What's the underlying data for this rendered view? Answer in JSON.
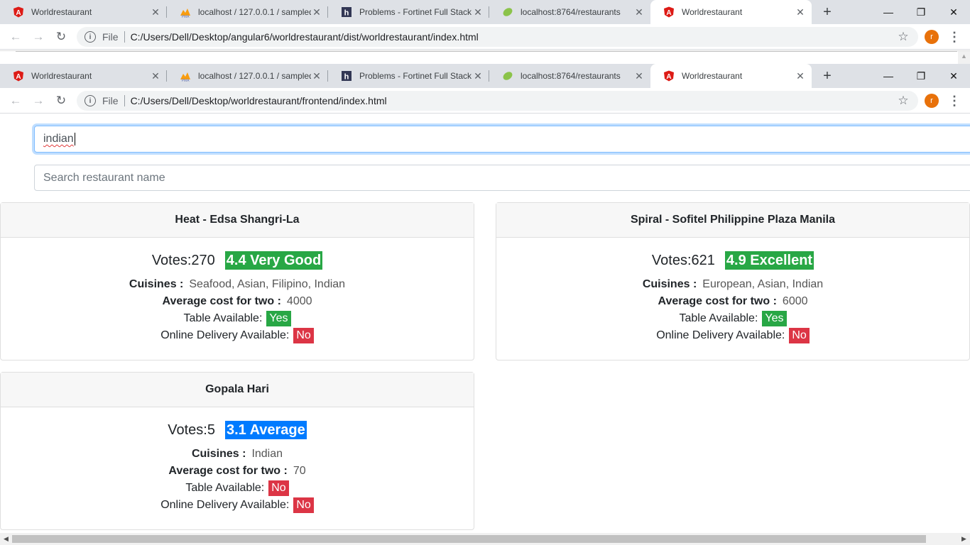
{
  "browser_back": {
    "tabs": [
      {
        "title": "Worldrestaurant",
        "icon": "angular-icon"
      },
      {
        "title": "localhost / 127.0.0.1 / sampled",
        "icon": "phpmyadmin-icon"
      },
      {
        "title": "Problems - Fortinet Full Stack",
        "icon": "hackerearth-icon"
      },
      {
        "title": "localhost:8764/restaurants",
        "icon": "spring-leaf-icon"
      },
      {
        "title": "Worldrestaurant",
        "icon": "angular-icon"
      }
    ],
    "omnibox": {
      "file_label": "File",
      "url": "C:/Users/Dell/Desktop/angular6/worldrestaurant/dist/worldrestaurant/index.html"
    }
  },
  "browser_front": {
    "tabs": [
      {
        "title": "Worldrestaurant",
        "icon": "angular-icon"
      },
      {
        "title": "localhost / 127.0.0.1 / sampled",
        "icon": "phpmyadmin-icon"
      },
      {
        "title": "Problems - Fortinet Full Stack",
        "icon": "hackerearth-icon"
      },
      {
        "title": "localhost:8764/restaurants",
        "icon": "spring-leaf-icon"
      },
      {
        "title": "Worldrestaurant",
        "icon": "angular-icon"
      }
    ],
    "omnibox": {
      "file_label": "File",
      "url": "C:/Users/Dell/Desktop/worldrestaurant/frontend/index.html"
    },
    "avatar_letter": "r"
  },
  "search": {
    "cuisine_value": "indian",
    "name_placeholder": "Search restaurant name"
  },
  "labels": {
    "votes": "Votes:",
    "cuisines": "Cuisines :",
    "avg_cost": "Average cost for two :",
    "table": "Table Available:",
    "delivery": "Online Delivery Available:"
  },
  "restaurants": [
    {
      "name": "Heat - Edsa Shangri-La",
      "votes": "270",
      "rating": "4.4 Very Good",
      "rating_color": "#28a745",
      "cuisines": "Seafood, Asian, Filipino, Indian",
      "avg_cost": "4000",
      "table": "Yes",
      "delivery": "No"
    },
    {
      "name": "Spiral - Sofitel Philippine Plaza Manila",
      "votes": "621",
      "rating": "4.9 Excellent",
      "rating_color": "#28a745",
      "cuisines": "European, Asian, Indian",
      "avg_cost": "6000",
      "table": "Yes",
      "delivery": "No"
    },
    {
      "name": "Gopala Hari",
      "votes": "5",
      "rating": "3.1 Average",
      "rating_color": "#007bff",
      "cuisines": "Indian",
      "avg_cost": "70",
      "table": "No",
      "delivery": "No"
    }
  ],
  "colors": {
    "yes": "#28a745",
    "no": "#dc3545",
    "tab_strip": "#dee1e6",
    "avatar": "#e8710a"
  }
}
